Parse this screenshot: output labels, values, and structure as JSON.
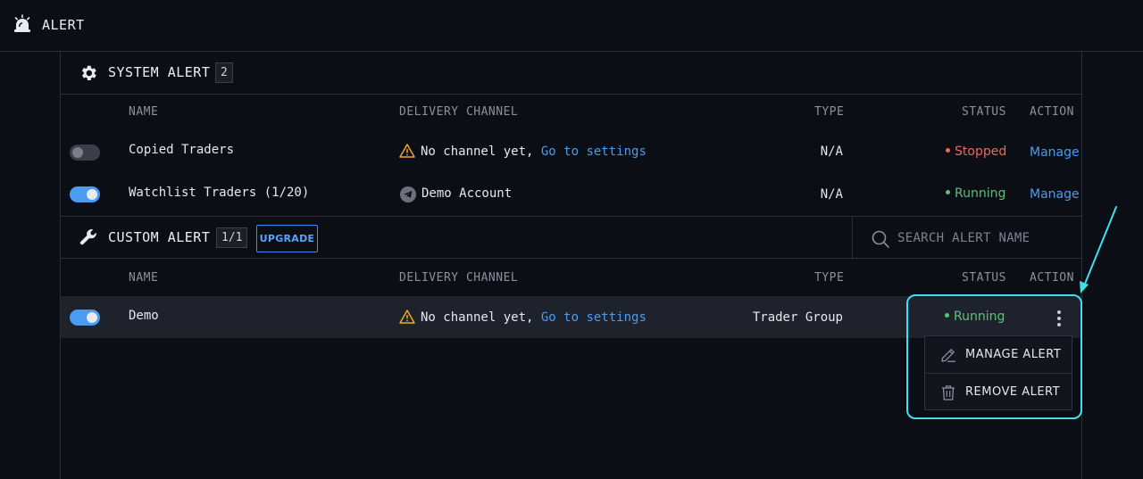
{
  "header": {
    "title": "ALERT",
    "icon": "alarm-bell-icon"
  },
  "system_alert": {
    "title": "SYSTEM ALERT",
    "count": "2",
    "icon": "gear-icon",
    "columns": {
      "name": "NAME",
      "delivery": "DELIVERY CHANNEL",
      "type": "TYPE",
      "status": "STATUS",
      "action": "ACTION"
    },
    "rows": [
      {
        "enabled": false,
        "name": "Copied Traders",
        "channel_prefix": "No channel yet,",
        "channel_link": "Go to settings",
        "type": "N/A",
        "status": "Stopped",
        "action": "Manage"
      },
      {
        "enabled": true,
        "name": "Watchlist Traders (1/20)",
        "channel": "Demo Account",
        "type": "N/A",
        "status": "Running",
        "action": "Manage"
      }
    ]
  },
  "custom_alert": {
    "title": "CUSTOM ALERT",
    "count": "1/1",
    "icon": "wrench-icon",
    "upgrade_label": "UPGRADE",
    "search_placeholder": "SEARCH ALERT NAME",
    "columns": {
      "name": "NAME",
      "delivery": "DELIVERY CHANNEL",
      "type": "TYPE",
      "status": "STATUS",
      "action": "ACTION"
    },
    "rows": [
      {
        "enabled": true,
        "name": "Demo",
        "channel_prefix": "No channel yet,",
        "channel_link": "Go to settings",
        "type": "Trader Group",
        "status": "Running"
      }
    ]
  },
  "action_menu": {
    "items": [
      {
        "label": "MANAGE ALERT",
        "icon": "pencil-icon"
      },
      {
        "label": "REMOVE ALERT",
        "icon": "trash-icon"
      }
    ]
  },
  "colors": {
    "background": "#0b0e15",
    "accent": "#4a9cf0",
    "running": "#5fc07a",
    "stopped": "#f0685a",
    "warning": "#f5a623",
    "callout": "#3ee0ee"
  }
}
